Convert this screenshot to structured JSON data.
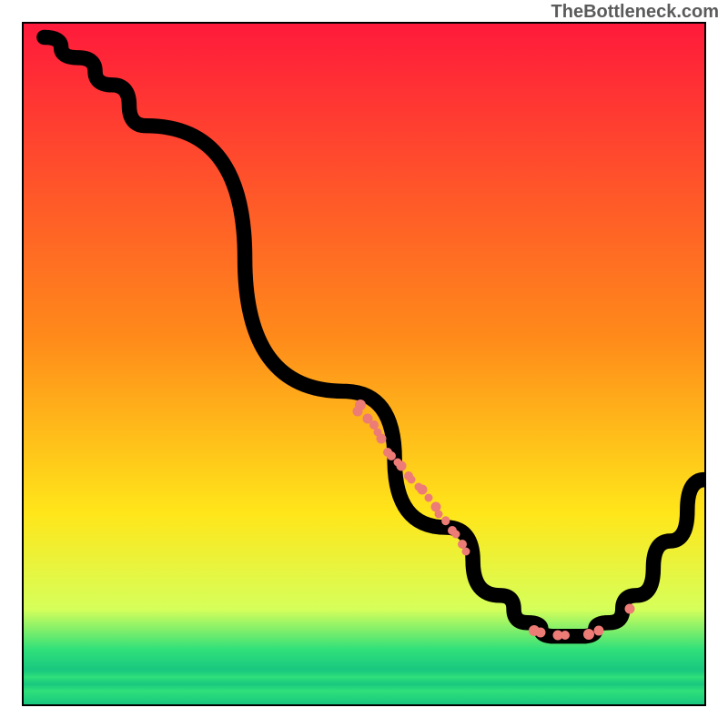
{
  "meta": {
    "source_label": "TheBottleneck.com"
  },
  "colors": {
    "point": "#ed7b76",
    "frame": "#000000",
    "gradient": {
      "top": "#ff1a3b",
      "orange": "#ff8a1a",
      "yellow": "#ffe61a",
      "light_green": "#d6ff5a",
      "green": "#2fe07a",
      "teal": "#19c77f"
    }
  },
  "chart_data": {
    "type": "line",
    "title": "",
    "xlabel": "",
    "ylabel": "",
    "xlim": [
      0,
      100
    ],
    "ylim": [
      0,
      100
    ],
    "grid": false,
    "curve": [
      {
        "x": 3,
        "y": 98
      },
      {
        "x": 8,
        "y": 95
      },
      {
        "x": 13,
        "y": 91
      },
      {
        "x": 18,
        "y": 85
      },
      {
        "x": 47,
        "y": 46
      },
      {
        "x": 62,
        "y": 26
      },
      {
        "x": 70,
        "y": 16
      },
      {
        "x": 74,
        "y": 12
      },
      {
        "x": 78,
        "y": 10
      },
      {
        "x": 82,
        "y": 10
      },
      {
        "x": 86,
        "y": 12
      },
      {
        "x": 90,
        "y": 16
      },
      {
        "x": 95,
        "y": 24
      },
      {
        "x": 100,
        "y": 33
      }
    ],
    "points": [
      {
        "x": 49.5,
        "y": 44,
        "r": 6
      },
      {
        "x": 49,
        "y": 43,
        "r": 5.5
      },
      {
        "x": 50.5,
        "y": 42,
        "r": 5.5
      },
      {
        "x": 51.5,
        "y": 41,
        "r": 5
      },
      {
        "x": 52.5,
        "y": 39,
        "r": 5.5
      },
      {
        "x": 52,
        "y": 40,
        "r": 4.5
      },
      {
        "x": 53.5,
        "y": 37,
        "r": 5
      },
      {
        "x": 54,
        "y": 36.5,
        "r": 5
      },
      {
        "x": 55,
        "y": 35.5,
        "r": 4.5
      },
      {
        "x": 55.5,
        "y": 35,
        "r": 5.5
      },
      {
        "x": 56.5,
        "y": 33.5,
        "r": 5
      },
      {
        "x": 57,
        "y": 33,
        "r": 4.5
      },
      {
        "x": 58,
        "y": 32,
        "r": 4.5
      },
      {
        "x": 58.5,
        "y": 31.5,
        "r": 5.5
      },
      {
        "x": 59.5,
        "y": 30.3,
        "r": 4.5
      },
      {
        "x": 60.5,
        "y": 29,
        "r": 5.5
      },
      {
        "x": 61,
        "y": 28,
        "r": 4.5
      },
      {
        "x": 62,
        "y": 27,
        "r": 4.8
      },
      {
        "x": 63,
        "y": 25.5,
        "r": 5
      },
      {
        "x": 63.5,
        "y": 25,
        "r": 4.5
      },
      {
        "x": 64.5,
        "y": 23.5,
        "r": 5
      },
      {
        "x": 65,
        "y": 22.5,
        "r": 4.5
      },
      {
        "x": 75,
        "y": 10.8,
        "r": 6
      },
      {
        "x": 76,
        "y": 10.5,
        "r": 5.5
      },
      {
        "x": 78.5,
        "y": 10.2,
        "r": 5.5
      },
      {
        "x": 79.5,
        "y": 10.1,
        "r": 5
      },
      {
        "x": 83,
        "y": 10.3,
        "r": 6
      },
      {
        "x": 84.5,
        "y": 10.8,
        "r": 5.5
      },
      {
        "x": 89,
        "y": 14,
        "r": 5.5
      }
    ]
  }
}
